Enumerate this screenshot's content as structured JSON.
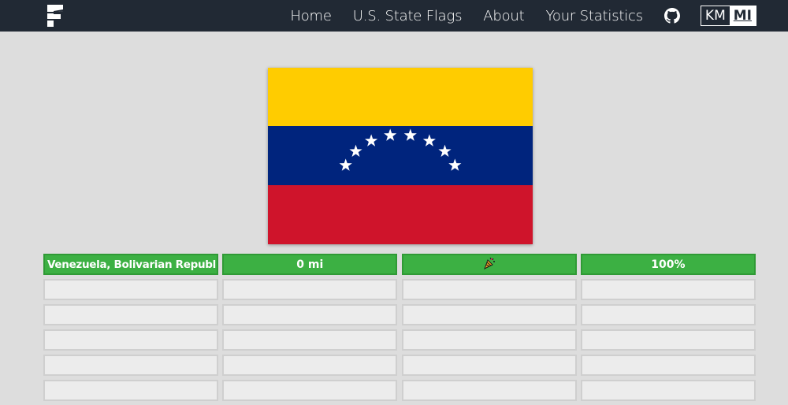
{
  "nav": {
    "logo_icon": "flagle-f-logo-icon",
    "links": [
      "Home",
      "U.S. State Flags",
      "About",
      "Your Statistics"
    ],
    "github_icon": "github-icon",
    "units": [
      "KM",
      "MI"
    ],
    "active_unit": "MI"
  },
  "flag": {
    "colors": {
      "top": "#ffcc00",
      "middle": "#00247d",
      "bottom": "#cf142b",
      "stars": "#ffffff"
    },
    "star_count": 8
  },
  "guesses": [
    {
      "country": "Venezuela, Bolivarian Republic of",
      "distance": "0 mi",
      "direction_icon": "party-popper-icon",
      "proximity": "100%",
      "status": "correct"
    }
  ],
  "empty_rows": 5,
  "colors": {
    "navbar": "#212934",
    "background": "#dddddd",
    "correct": "#3cb043",
    "empty_cell": "#ececec"
  }
}
